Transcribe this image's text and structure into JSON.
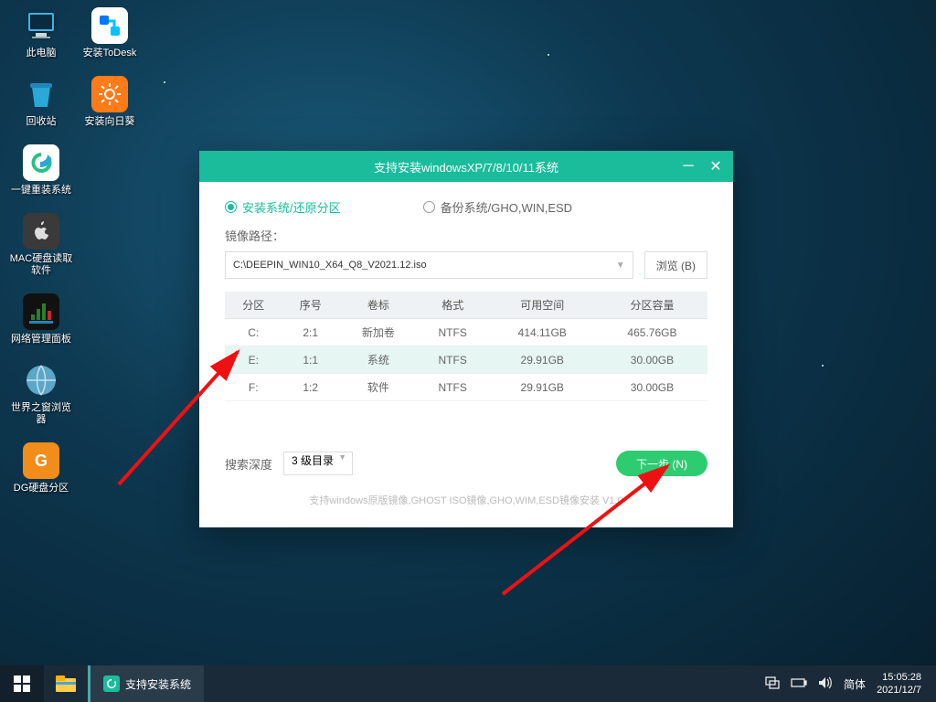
{
  "desktop_icons_col1": [
    {
      "name": "此电脑",
      "id": "this-pc"
    },
    {
      "name": "回收站",
      "id": "recycle-bin"
    },
    {
      "name": "一键重装系统",
      "id": "one-click-reinstall"
    },
    {
      "name": "MAC硬盘读取软件",
      "id": "mac-disk-reader"
    },
    {
      "name": "网络管理面板",
      "id": "network-panel"
    },
    {
      "name": "世界之窗浏览器",
      "id": "theworld-browser"
    },
    {
      "name": "DG硬盘分区",
      "id": "dg-partition"
    }
  ],
  "desktop_icons_col2": [
    {
      "name": "安装ToDesk",
      "id": "install-todesk"
    },
    {
      "name": "安装向日葵",
      "id": "install-sunflower"
    }
  ],
  "window": {
    "title": "支持安装windowsXP/7/8/10/11系统",
    "radio1": "安装系统/还原分区",
    "radio2": "备份系统/GHO,WIN,ESD",
    "image_path_label": "镜像路径：",
    "image_path": "C:\\DEEPIN_WIN10_X64_Q8_V2021.12.iso",
    "browse": "浏览 (B)",
    "headers": [
      "分区",
      "序号",
      "卷标",
      "格式",
      "可用空间",
      "分区容量"
    ],
    "rows": [
      {
        "part": "C:",
        "idx": "2:1",
        "label": "新加卷",
        "fmt": "NTFS",
        "free": "414.11GB",
        "total": "465.76GB",
        "sel": false
      },
      {
        "part": "E:",
        "idx": "1:1",
        "label": "系统",
        "fmt": "NTFS",
        "free": "29.91GB",
        "total": "30.00GB",
        "sel": true
      },
      {
        "part": "F:",
        "idx": "1:2",
        "label": "软件",
        "fmt": "NTFS",
        "free": "29.91GB",
        "total": "30.00GB",
        "sel": false
      }
    ],
    "depth_label": "搜索深度",
    "depth_value": "3 级目录",
    "next": "下一步 (N)",
    "footnote": "支持windows原版镜像,GHOST ISO镜像,GHO,WIM,ESD镜像安装   V1.0"
  },
  "taskbar": {
    "app": "支持安装系统",
    "ime": "简体",
    "time": "15:05:28",
    "date": "2021/12/7"
  }
}
